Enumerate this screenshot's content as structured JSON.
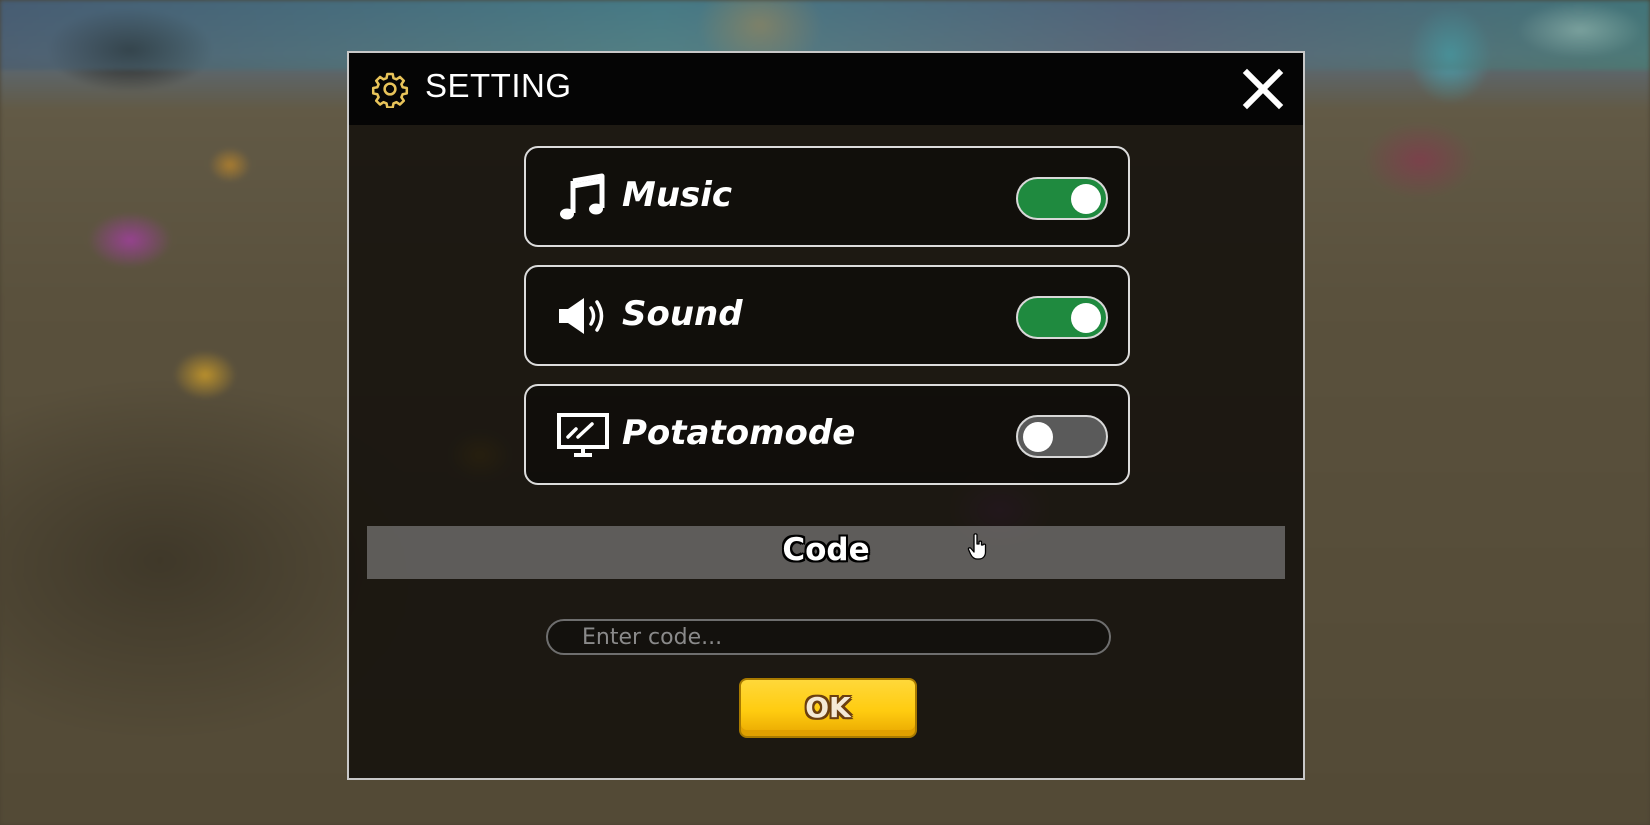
{
  "dialog": {
    "title": "SETTING",
    "title_icon": "gear-icon",
    "close_icon": "close-icon"
  },
  "settings": [
    {
      "label": "Music",
      "icon": "music-note-icon",
      "enabled": true
    },
    {
      "label": "Sound",
      "icon": "speaker-icon",
      "enabled": true
    },
    {
      "label": "Potatomode",
      "icon": "monitor-icon",
      "enabled": false
    }
  ],
  "code_section": {
    "heading": "Code",
    "input_placeholder": "Enter code...",
    "input_value": "",
    "submit_label": "OK"
  },
  "colors": {
    "toggle_on": "#1f8a3f",
    "toggle_off": "#5a5a5a",
    "ok_button": "#ffcc10",
    "gear_icon": "#e8c45a"
  }
}
